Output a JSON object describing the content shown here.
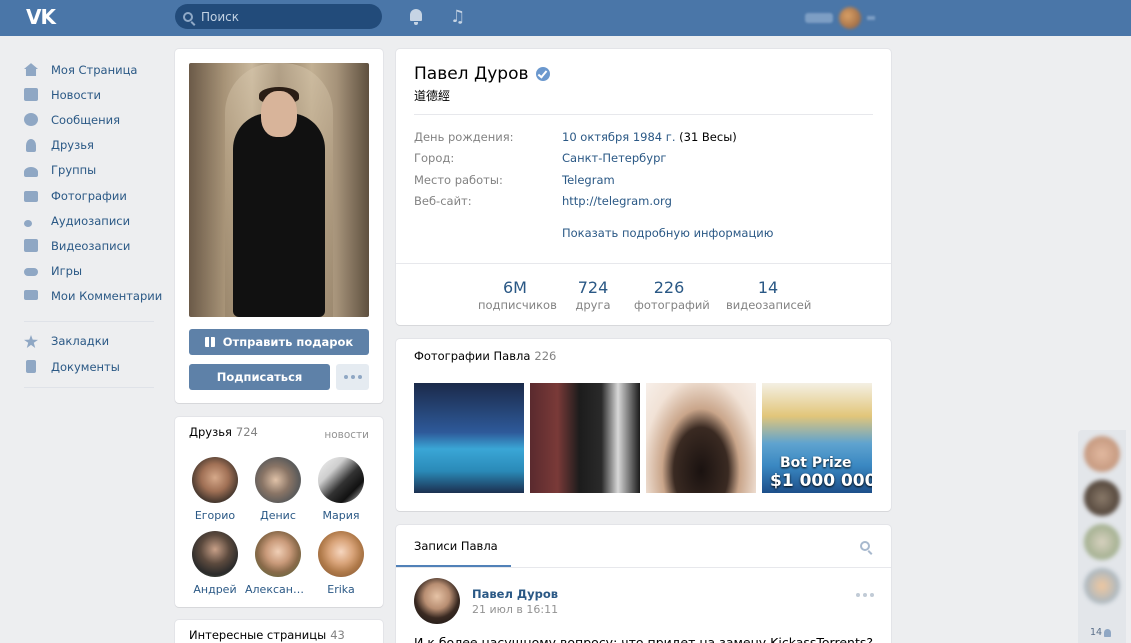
{
  "header": {
    "logo": "VK",
    "search_placeholder": "Поиск",
    "icons": [
      "bell-icon",
      "music-note-icon"
    ]
  },
  "sidebar": {
    "items": [
      {
        "label": "Моя Страница",
        "icon": "home-icon"
      },
      {
        "label": "Новости",
        "icon": "news-icon"
      },
      {
        "label": "Сообщения",
        "icon": "message-icon"
      },
      {
        "label": "Друзья",
        "icon": "user-icon"
      },
      {
        "label": "Группы",
        "icon": "group-icon"
      },
      {
        "label": "Фотографии",
        "icon": "camera-icon"
      },
      {
        "label": "Аудиозаписи",
        "icon": "music-icon"
      },
      {
        "label": "Видеозаписи",
        "icon": "video-icon"
      },
      {
        "label": "Игры",
        "icon": "gamepad-icon"
      },
      {
        "label": "Мои Комментарии",
        "icon": "comment-icon"
      }
    ],
    "extra": [
      {
        "label": "Закладки",
        "icon": "star-icon"
      },
      {
        "label": "Документы",
        "icon": "document-icon"
      }
    ]
  },
  "profile_actions": {
    "gift_label": "Отправить подарок",
    "subscribe_label": "Подписаться"
  },
  "friends": {
    "title": "Друзья",
    "count": "724",
    "news_link": "новости",
    "list": [
      {
        "name": "Егорио"
      },
      {
        "name": "Денис"
      },
      {
        "name": "Мария"
      },
      {
        "name": "Андрей"
      },
      {
        "name": "Александ..."
      },
      {
        "name": "Erika"
      }
    ]
  },
  "interesting": {
    "title": "Интересные страницы",
    "count": "43"
  },
  "profile": {
    "name": "Павел Дуров",
    "status": "道德經",
    "rows": [
      {
        "label": "День рождения:",
        "value": "10 октября 1984 г.",
        "extra": "(31 Весы)"
      },
      {
        "label": "Город:",
        "value": "Санкт-Петербург",
        "extra": ""
      },
      {
        "label": "Место работы:",
        "value": "Telegram",
        "extra": ""
      },
      {
        "label": "Веб-сайт:",
        "value": "http://telegram.org",
        "extra": ""
      }
    ],
    "more_info": "Показать подробную информацию",
    "counters": [
      {
        "num": "6M",
        "label": "подписчиков"
      },
      {
        "num": "724",
        "label": "друга"
      },
      {
        "num": "226",
        "label": "фотографий"
      },
      {
        "num": "14",
        "label": "видеозаписей"
      }
    ]
  },
  "photos": {
    "title": "Фотографии Павла",
    "count": "226",
    "bot_prize_line1": "Bot Prize",
    "bot_prize_line2": "$1 000 000"
  },
  "wall": {
    "tab": "Записи Павла",
    "post": {
      "author": "Павел Дуров",
      "date": "21 июл в 16:11",
      "text": "И к более насущному вопросу: что придет на замену KickassTorrents?"
    }
  },
  "dock": {
    "count": "14"
  }
}
